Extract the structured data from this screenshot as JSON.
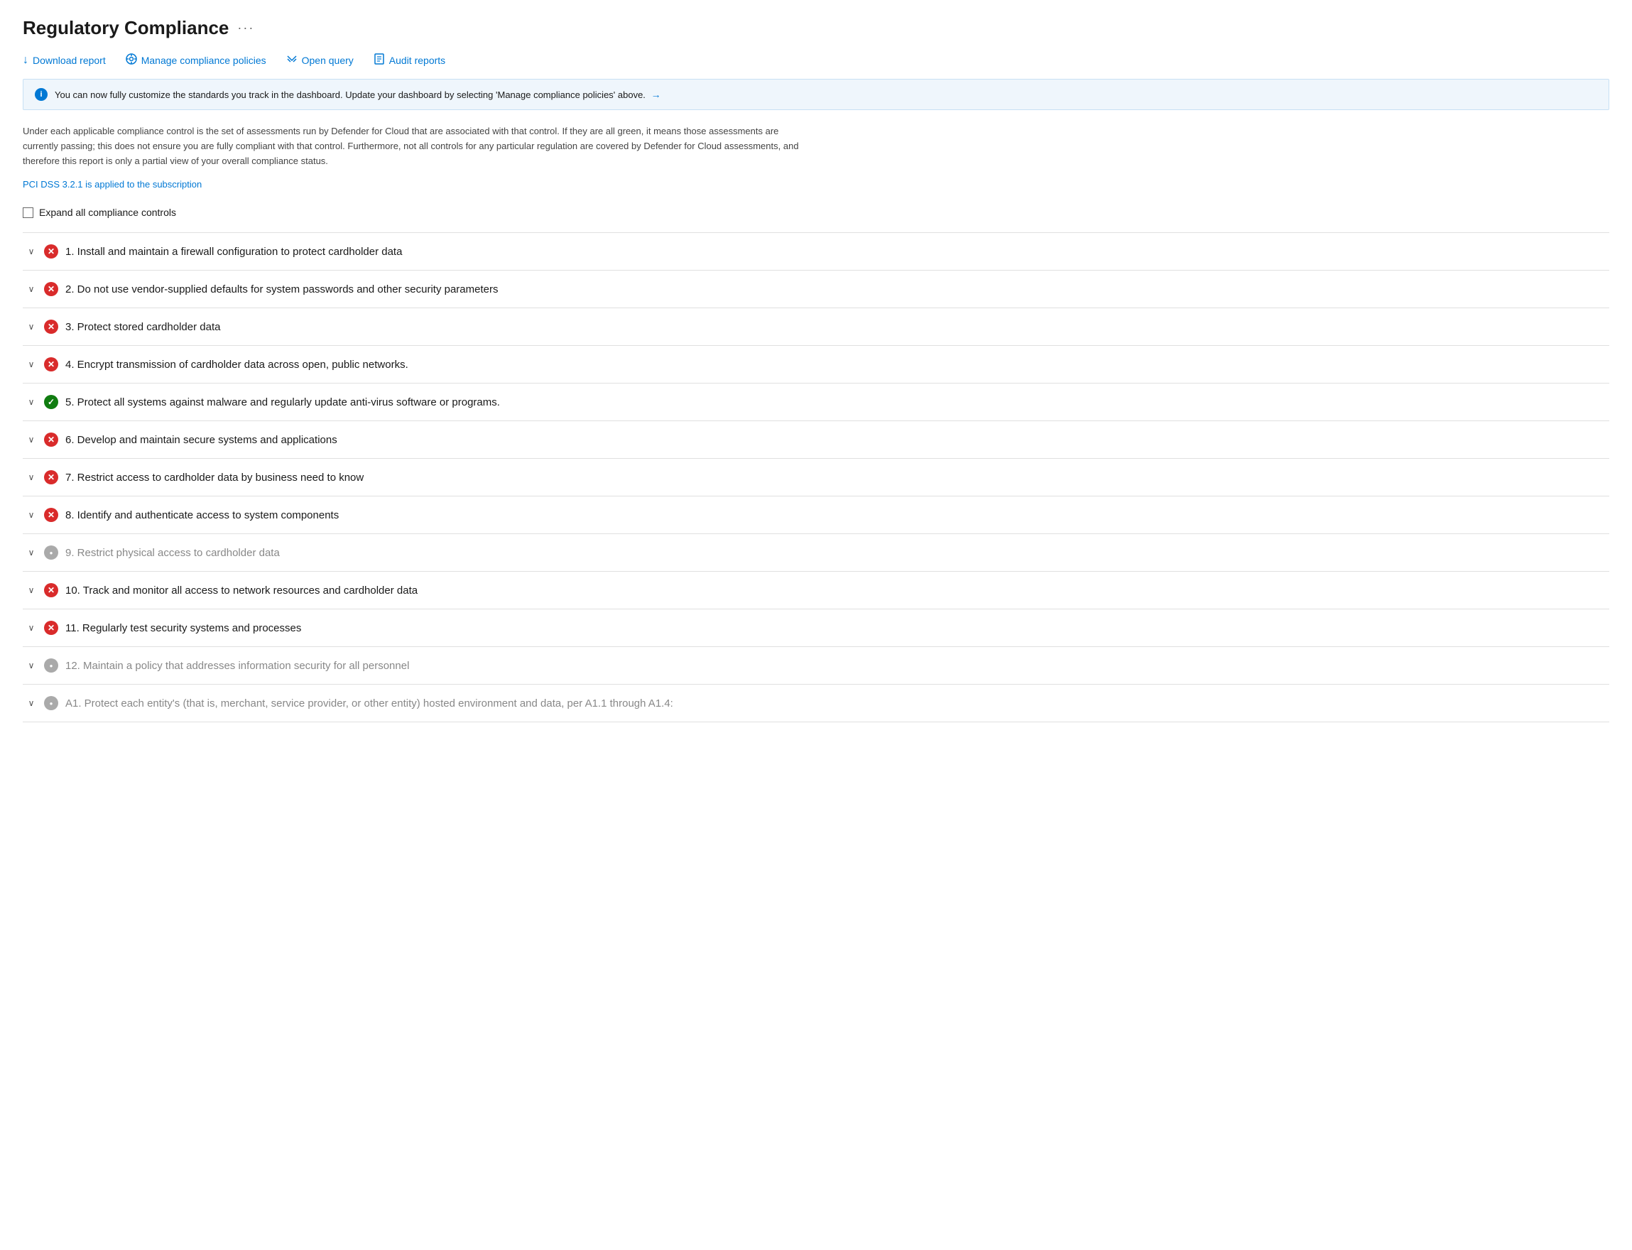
{
  "page": {
    "title": "Regulatory Compliance",
    "ellipsis": "···"
  },
  "toolbar": {
    "download_label": "Download report",
    "download_icon": "↓",
    "manage_label": "Manage compliance policies",
    "manage_icon": "⊙",
    "query_label": "Open query",
    "query_icon": "⑂",
    "audit_label": "Audit reports",
    "audit_icon": "☰"
  },
  "info_banner": {
    "text": "You can now fully customize the standards you track in the dashboard. Update your dashboard by selecting 'Manage compliance policies' above.",
    "arrow": "→"
  },
  "description": "Under each applicable compliance control is the set of assessments run by Defender for Cloud that are associated with that control. If they are all green, it means those assessments are currently passing; this does not ensure you are fully compliant with that control. Furthermore, not all controls for any particular regulation are covered by Defender for Cloud assessments, and therefore this report is only a partial view of your overall compliance status.",
  "pci_link": "PCI DSS 3.2.1 is applied to the subscription",
  "expand_label": "Expand all compliance controls",
  "items": [
    {
      "id": 1,
      "label": "1. Install and maintain a firewall configuration to protect cardholder data",
      "status": "red",
      "enabled": true
    },
    {
      "id": 2,
      "label": "2. Do not use vendor-supplied defaults for system passwords and other security parameters",
      "status": "red",
      "enabled": true
    },
    {
      "id": 3,
      "label": "3. Protect stored cardholder data",
      "status": "red",
      "enabled": true
    },
    {
      "id": 4,
      "label": "4. Encrypt transmission of cardholder data across open, public networks.",
      "status": "red",
      "enabled": true
    },
    {
      "id": 5,
      "label": "5. Protect all systems against malware and regularly update anti-virus software or programs.",
      "status": "green",
      "enabled": true
    },
    {
      "id": 6,
      "label": "6. Develop and maintain secure systems and applications",
      "status": "red",
      "enabled": true
    },
    {
      "id": 7,
      "label": "7. Restrict access to cardholder data by business need to know",
      "status": "red",
      "enabled": true
    },
    {
      "id": 8,
      "label": "8. Identify and authenticate access to system components",
      "status": "red",
      "enabled": true
    },
    {
      "id": 9,
      "label": "9. Restrict physical access to cardholder data",
      "status": "gray",
      "enabled": false
    },
    {
      "id": 10,
      "label": "10. Track and monitor all access to network resources and cardholder data",
      "status": "red",
      "enabled": true
    },
    {
      "id": 11,
      "label": "11. Regularly test security systems and processes",
      "status": "red",
      "enabled": true
    },
    {
      "id": 12,
      "label": "12. Maintain a policy that addresses information security for all personnel",
      "status": "gray",
      "enabled": false
    },
    {
      "id": 13,
      "label": "A1. Protect each entity's (that is, merchant, service provider, or other entity) hosted environment and data, per A1.1 through A1.4:",
      "status": "gray",
      "enabled": false
    }
  ]
}
